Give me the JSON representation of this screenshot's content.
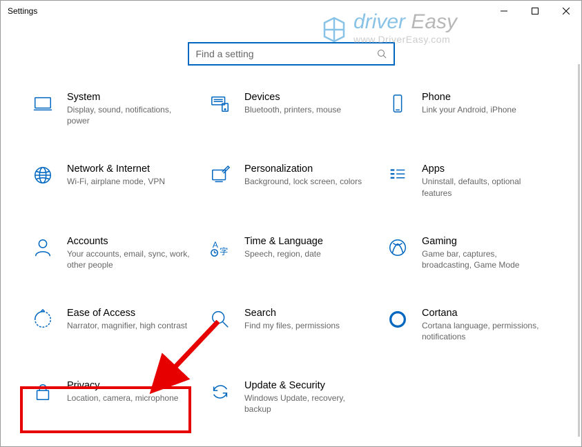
{
  "window": {
    "title": "Settings"
  },
  "search": {
    "placeholder": "Find a setting"
  },
  "tiles": {
    "system": {
      "title": "System",
      "desc": "Display, sound, notifications, power"
    },
    "devices": {
      "title": "Devices",
      "desc": "Bluetooth, printers, mouse"
    },
    "phone": {
      "title": "Phone",
      "desc": "Link your Android, iPhone"
    },
    "network": {
      "title": "Network & Internet",
      "desc": "Wi-Fi, airplane mode, VPN"
    },
    "personal": {
      "title": "Personalization",
      "desc": "Background, lock screen, colors"
    },
    "apps": {
      "title": "Apps",
      "desc": "Uninstall, defaults, optional features"
    },
    "accounts": {
      "title": "Accounts",
      "desc": "Your accounts, email, sync, work, other people"
    },
    "time": {
      "title": "Time & Language",
      "desc": "Speech, region, date"
    },
    "gaming": {
      "title": "Gaming",
      "desc": "Game bar, captures, broadcasting, Game Mode"
    },
    "ease": {
      "title": "Ease of Access",
      "desc": "Narrator, magnifier, high contrast"
    },
    "searchc": {
      "title": "Search",
      "desc": "Find my files, permissions"
    },
    "cortana": {
      "title": "Cortana",
      "desc": "Cortana language, permissions, notifications"
    },
    "privacy": {
      "title": "Privacy",
      "desc": "Location, camera, microphone"
    },
    "update": {
      "title": "Update & Security",
      "desc": "Windows Update, recovery, backup"
    }
  },
  "watermark": {
    "line1a": "driver",
    "line1b": " Easy",
    "line2": "www.DriverEasy.com"
  }
}
